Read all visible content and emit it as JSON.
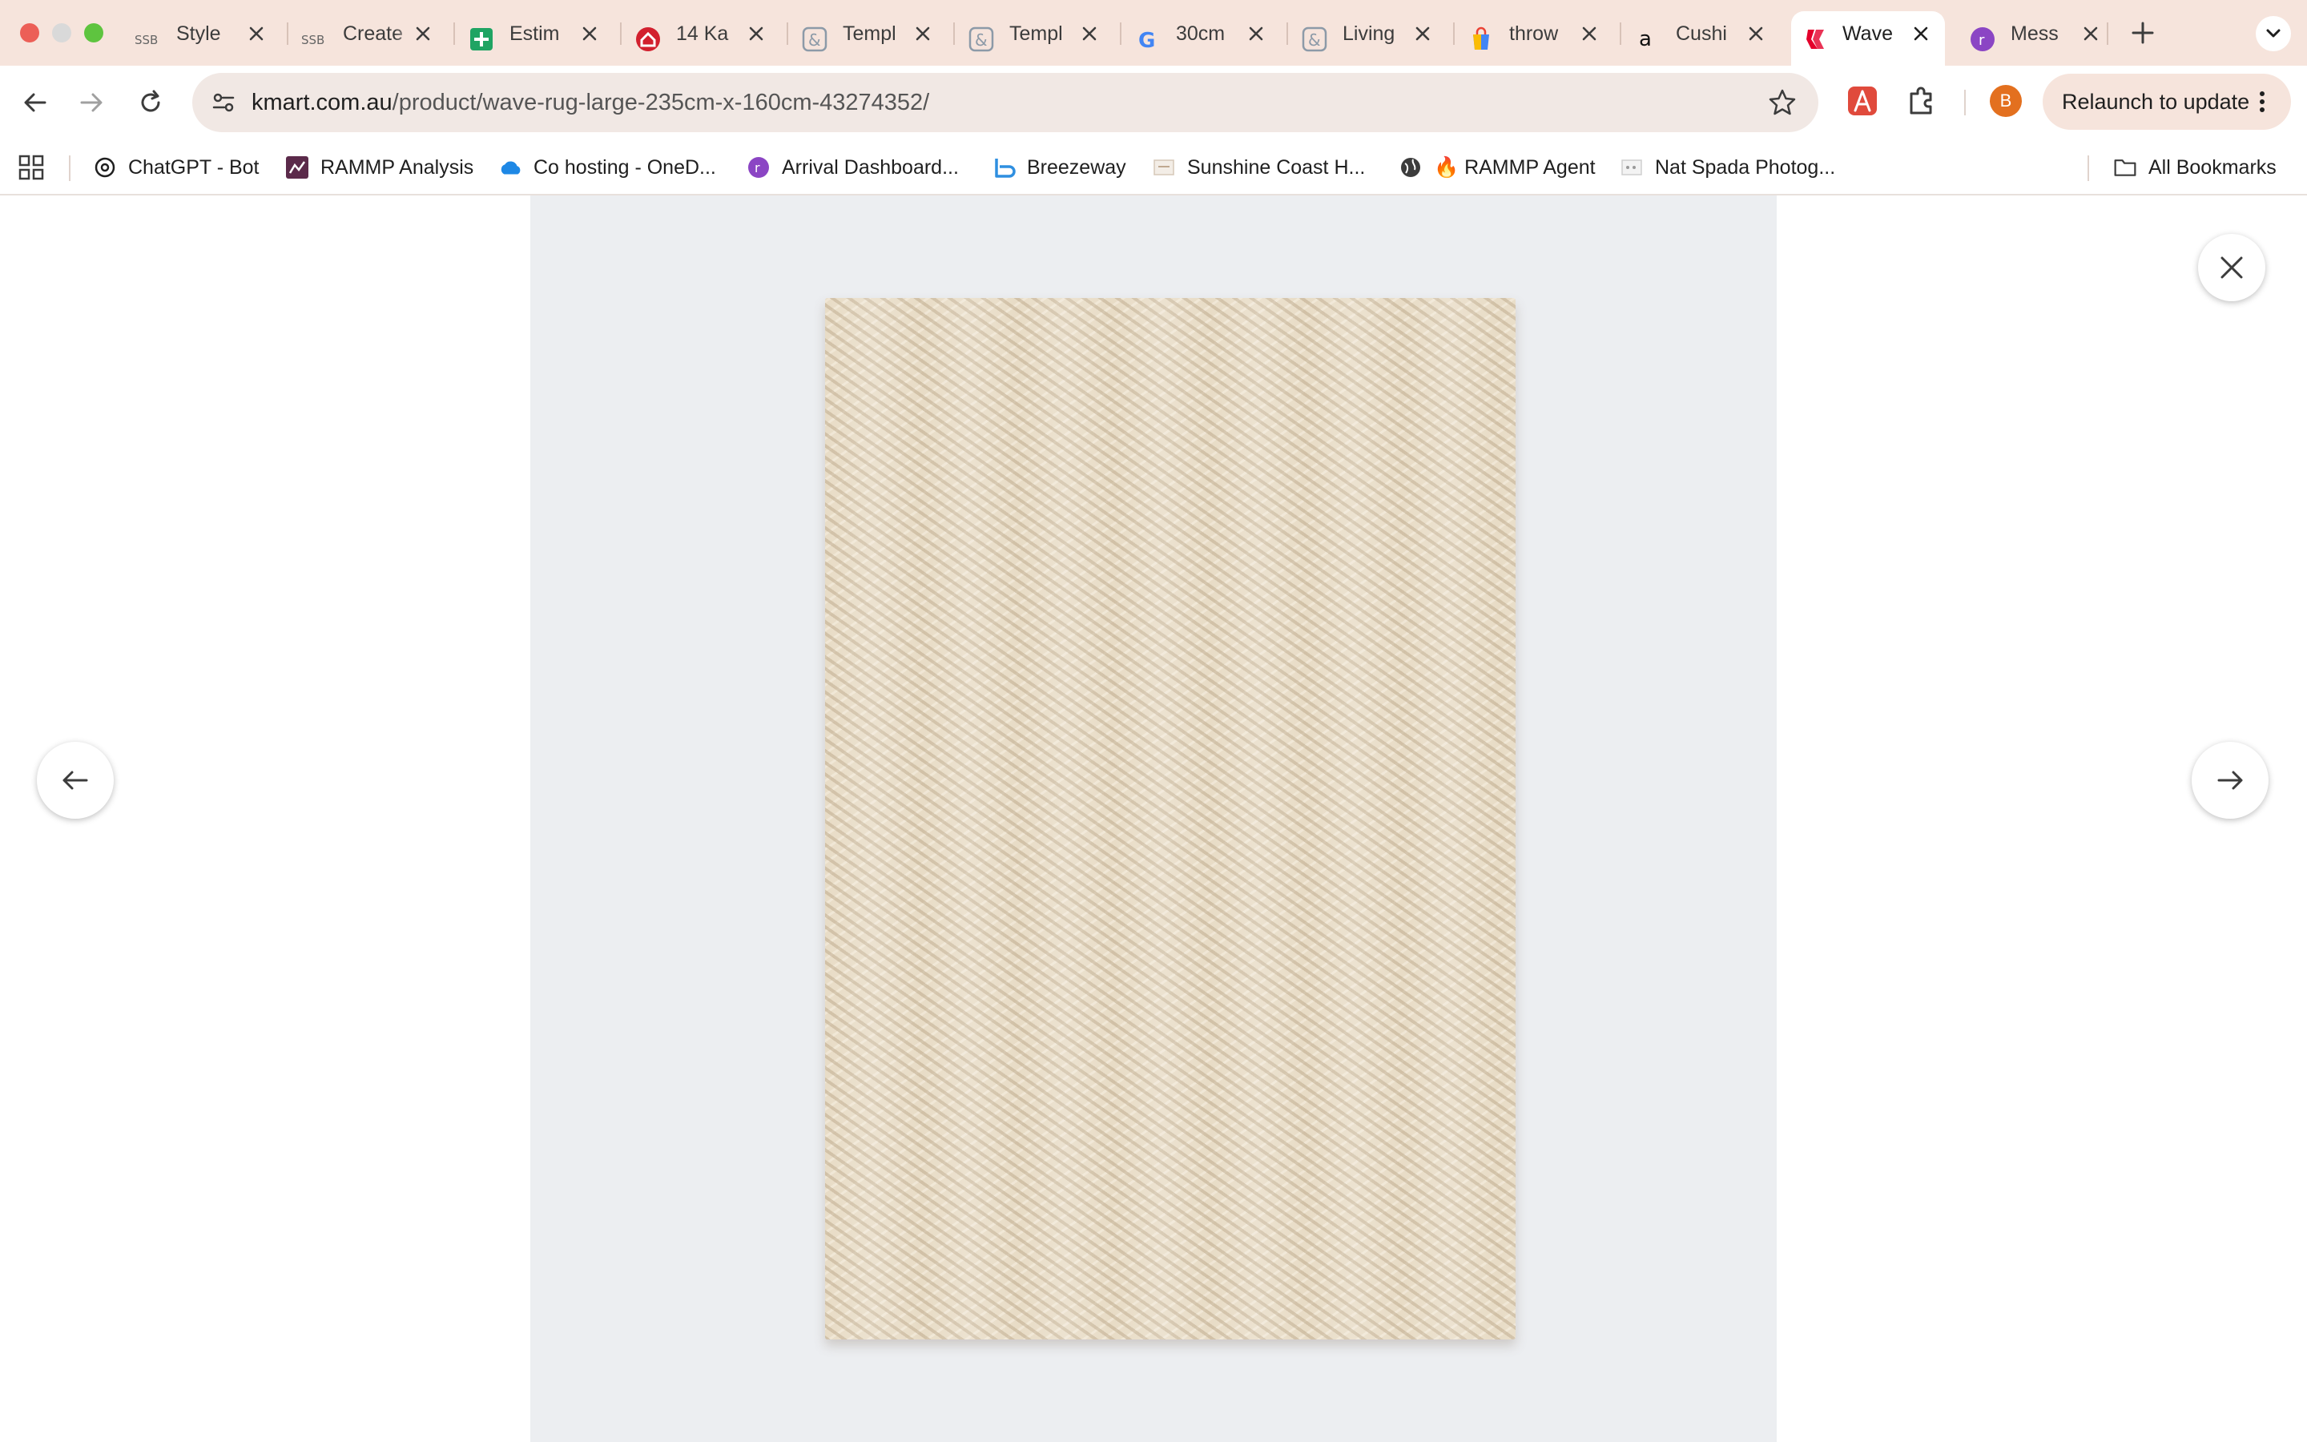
{
  "browser": {
    "tabs": [
      {
        "title": "Style",
        "favicon": "ssb-icon"
      },
      {
        "title": "Create",
        "favicon": "ssb-icon"
      },
      {
        "title": "Estim",
        "favicon": "sheets-icon"
      },
      {
        "title": "14 Ka",
        "favicon": "home-icon"
      },
      {
        "title": "Templ",
        "favicon": "ampersand-icon"
      },
      {
        "title": "Templ",
        "favicon": "ampersand-icon"
      },
      {
        "title": "30cm",
        "favicon": "google-icon"
      },
      {
        "title": "Living",
        "favicon": "ampersand-icon"
      },
      {
        "title": "throw",
        "favicon": "bag-icon"
      },
      {
        "title": "Cushi",
        "favicon": "amazon-icon"
      },
      {
        "title": "Wave",
        "favicon": "kmart-icon",
        "active": true
      },
      {
        "title": "Mess",
        "favicon": "messenger-icon"
      }
    ],
    "url": {
      "domain": "kmart.com.au",
      "path": "/product/wave-rug-large-235cm-x-160cm-43274352/"
    },
    "profile_initial": "B",
    "relaunch_label": "Relaunch to update",
    "bookmarks": [
      {
        "label": "ChatGPT - Bot",
        "icon": "openai-icon"
      },
      {
        "label": "RAMMP Analysis",
        "icon": "chart-icon"
      },
      {
        "label": "Co hosting - OneD...",
        "icon": "onedrive-icon"
      },
      {
        "label": "Arrival Dashboard...",
        "icon": "circle-logo-icon"
      },
      {
        "label": "Breezeway",
        "icon": "breezeway-icon"
      },
      {
        "label": "Sunshine Coast H...",
        "icon": "page-icon"
      },
      {
        "label": "🔥 RAMMP Agent",
        "icon": "globe-icon"
      },
      {
        "label": "Nat Spada Photog...",
        "icon": "page-icon"
      }
    ],
    "all_bookmarks_label": "All Bookmarks"
  },
  "colors": {
    "tabstrip_bg": "#f6e4dc",
    "stage_bg": "#eceef1",
    "rug_base": "#e8dcc6",
    "avatar_bg": "#e3701f"
  }
}
